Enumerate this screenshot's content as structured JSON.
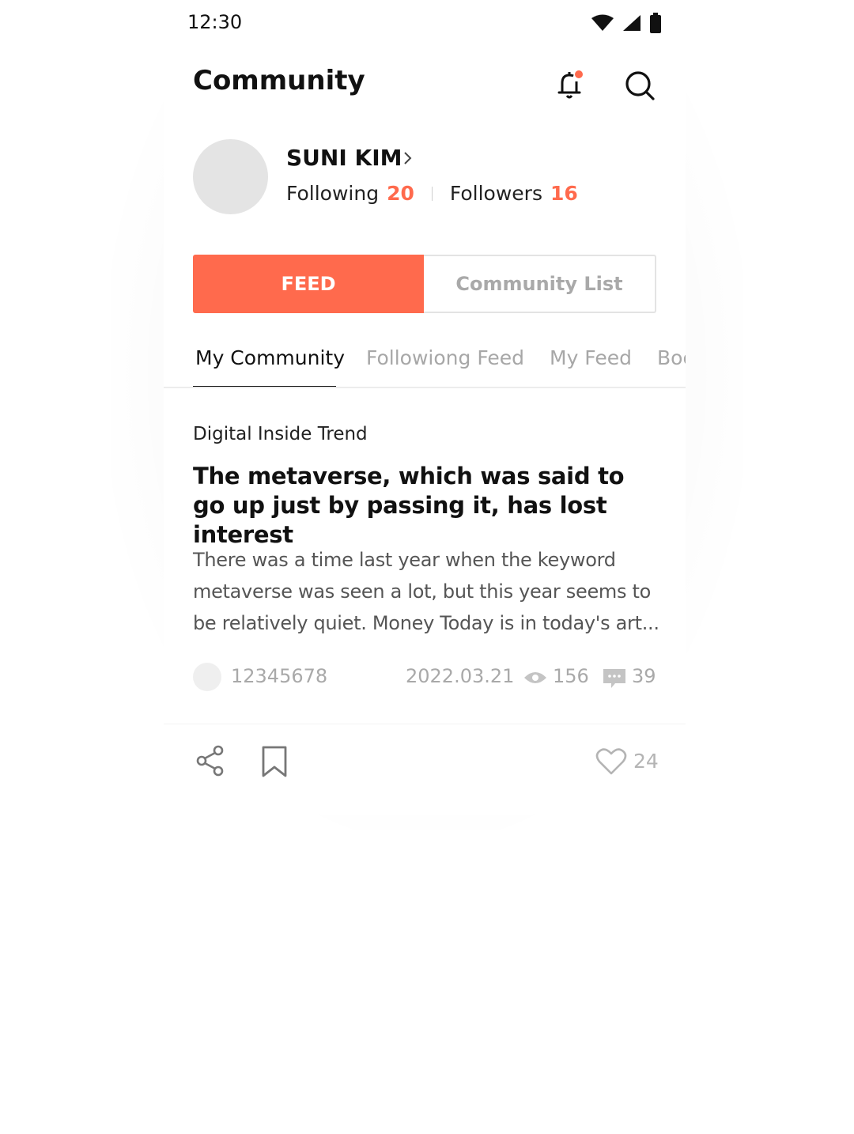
{
  "status_bar": {
    "time": "12:30"
  },
  "header": {
    "title": "Community"
  },
  "profile": {
    "name": "SUNI KIM",
    "following_label": "Following",
    "following_count": "20",
    "followers_label": "Followers",
    "followers_count": "16"
  },
  "segmented": {
    "active_label": "FEED",
    "inactive_label": "Community List"
  },
  "tabs": [
    "My Community",
    "Followiong Feed",
    "My Feed",
    "Boo"
  ],
  "article": {
    "category": "Digital Inside Trend",
    "title": "The metaverse, which was said to go up just by passing it, has lost interest",
    "summary": "There was a time last year when the keyword metaverse was seen a lot, but this year seems to be relatively quiet. Money Today is in today's art...",
    "author": "12345678",
    "date": "2022.03.21",
    "views": "156",
    "comments": "39",
    "likes": "24"
  },
  "colors": {
    "accent": "#ff6a4d",
    "muted": "#a9a9a9"
  },
  "icons": [
    "wifi-icon",
    "signal-icon",
    "battery-icon",
    "bell-icon",
    "search-icon",
    "chevron-right-icon",
    "eye-icon",
    "comment-icon",
    "share-icon",
    "bookmark-icon",
    "heart-icon"
  ]
}
